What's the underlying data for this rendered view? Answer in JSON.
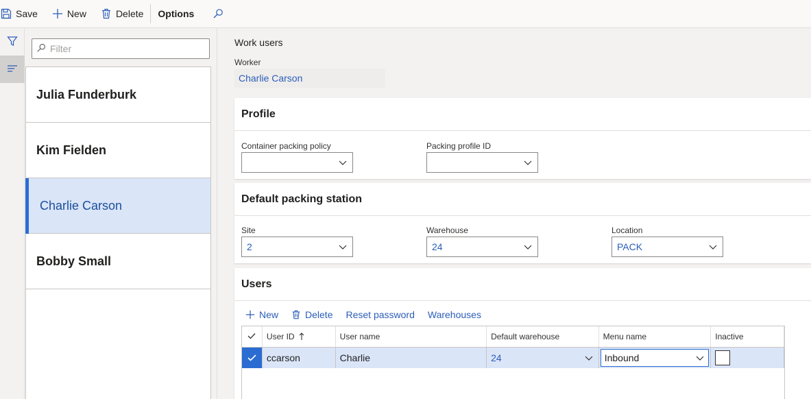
{
  "toolbar": {
    "save": "Save",
    "new": "New",
    "delete": "Delete",
    "options": "Options"
  },
  "filter": {
    "placeholder": "Filter"
  },
  "list": {
    "items": [
      {
        "label": "Julia Funderburk"
      },
      {
        "label": "Kim Fielden"
      },
      {
        "label": "Charlie Carson",
        "selected": true
      },
      {
        "label": "Bobby Small"
      }
    ]
  },
  "main": {
    "caption": "Work users",
    "worker_label": "Worker",
    "worker_value": "Charlie Carson"
  },
  "profile": {
    "title": "Profile",
    "container_policy_label": "Container packing policy",
    "container_policy_value": "",
    "packing_profile_label": "Packing profile ID",
    "packing_profile_value": ""
  },
  "station": {
    "title": "Default packing station",
    "site_label": "Site",
    "site_value": "2",
    "warehouse_label": "Warehouse",
    "warehouse_value": "24",
    "location_label": "Location",
    "location_value": "PACK"
  },
  "users": {
    "title": "Users",
    "actions": {
      "new": "New",
      "delete": "Delete",
      "reset_password": "Reset password",
      "warehouses": "Warehouses"
    },
    "columns": {
      "user_id": "User ID",
      "user_name": "User name",
      "default_warehouse": "Default warehouse",
      "menu_name": "Menu name",
      "inactive": "Inactive"
    },
    "rows": [
      {
        "user_id": "ccarson",
        "user_name": "Charlie",
        "default_warehouse": "24",
        "menu_name": "Inbound",
        "inactive": false
      }
    ]
  },
  "colors": {
    "accent": "#2b6cd2",
    "link": "#2b5db8",
    "selected_bg": "#dae5f8"
  }
}
